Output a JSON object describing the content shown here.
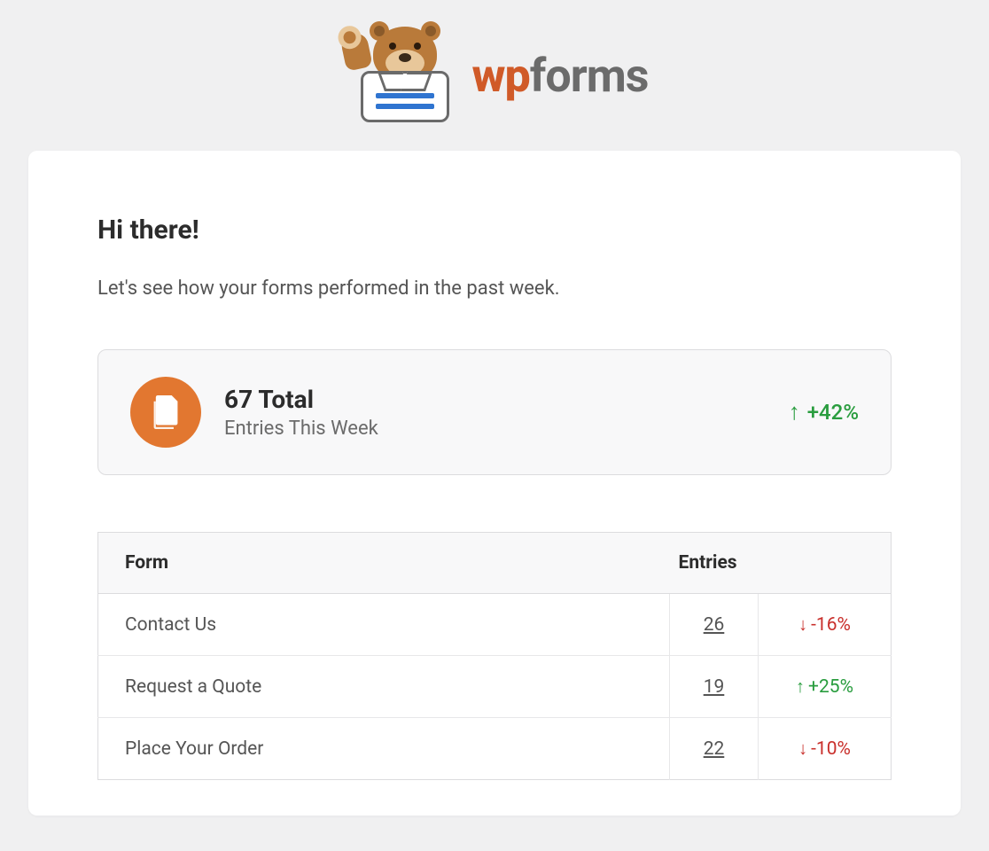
{
  "brand": {
    "wp": "wp",
    "forms": "forms"
  },
  "greeting": "Hi there!",
  "intro": "Let's see how your forms performed in the past week.",
  "summary": {
    "total_label": "67 Total",
    "subtitle": "Entries This Week",
    "trend_direction": "up",
    "trend_value": "+42%"
  },
  "table": {
    "headers": {
      "form": "Form",
      "entries": "Entries"
    },
    "rows": [
      {
        "name": "Contact Us",
        "count": "26",
        "direction": "down",
        "delta": "-16%"
      },
      {
        "name": "Request a Quote",
        "count": "19",
        "direction": "up",
        "delta": "+25%"
      },
      {
        "name": "Place Your Order",
        "count": "22",
        "direction": "down",
        "delta": "-10%"
      }
    ]
  }
}
